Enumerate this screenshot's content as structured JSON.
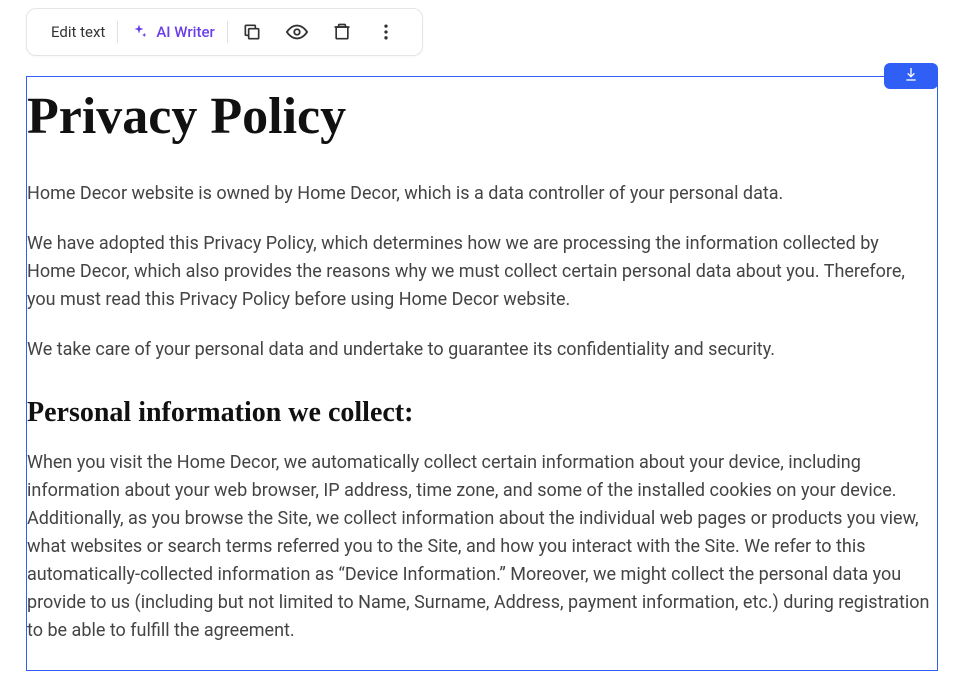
{
  "toolbar": {
    "edit_text": "Edit text",
    "ai_writer": "AI Writer"
  },
  "document": {
    "title": "Privacy Policy",
    "para1": "Home Decor website is owned by Home Decor, which is a data controller of your personal data.",
    "para2": "We have adopted this Privacy Policy, which determines how we are processing the information collected by Home Decor, which also provides the reasons why we must collect certain personal data about you. Therefore, you must read this Privacy Policy before using Home Decor website.",
    "para3": "We take care of your personal data and undertake to guarantee its confidentiality and security.",
    "section1_title": "Personal information we collect:",
    "section1_body": "When you visit the Home Decor, we automatically collect certain information about your device, including information about your web browser, IP address, time zone, and some of the installed cookies on your device. Additionally, as you browse the Site, we collect information about the individual web pages or products you view, what websites or search terms referred you to the Site, and how you interact with the Site. We refer to this automatically-collected information as “Device Information.” Moreover, we might collect the personal data you provide to us (including but not limited to Name, Surname, Address, payment information, etc.) during registration to be able to fulfill the agreement."
  }
}
